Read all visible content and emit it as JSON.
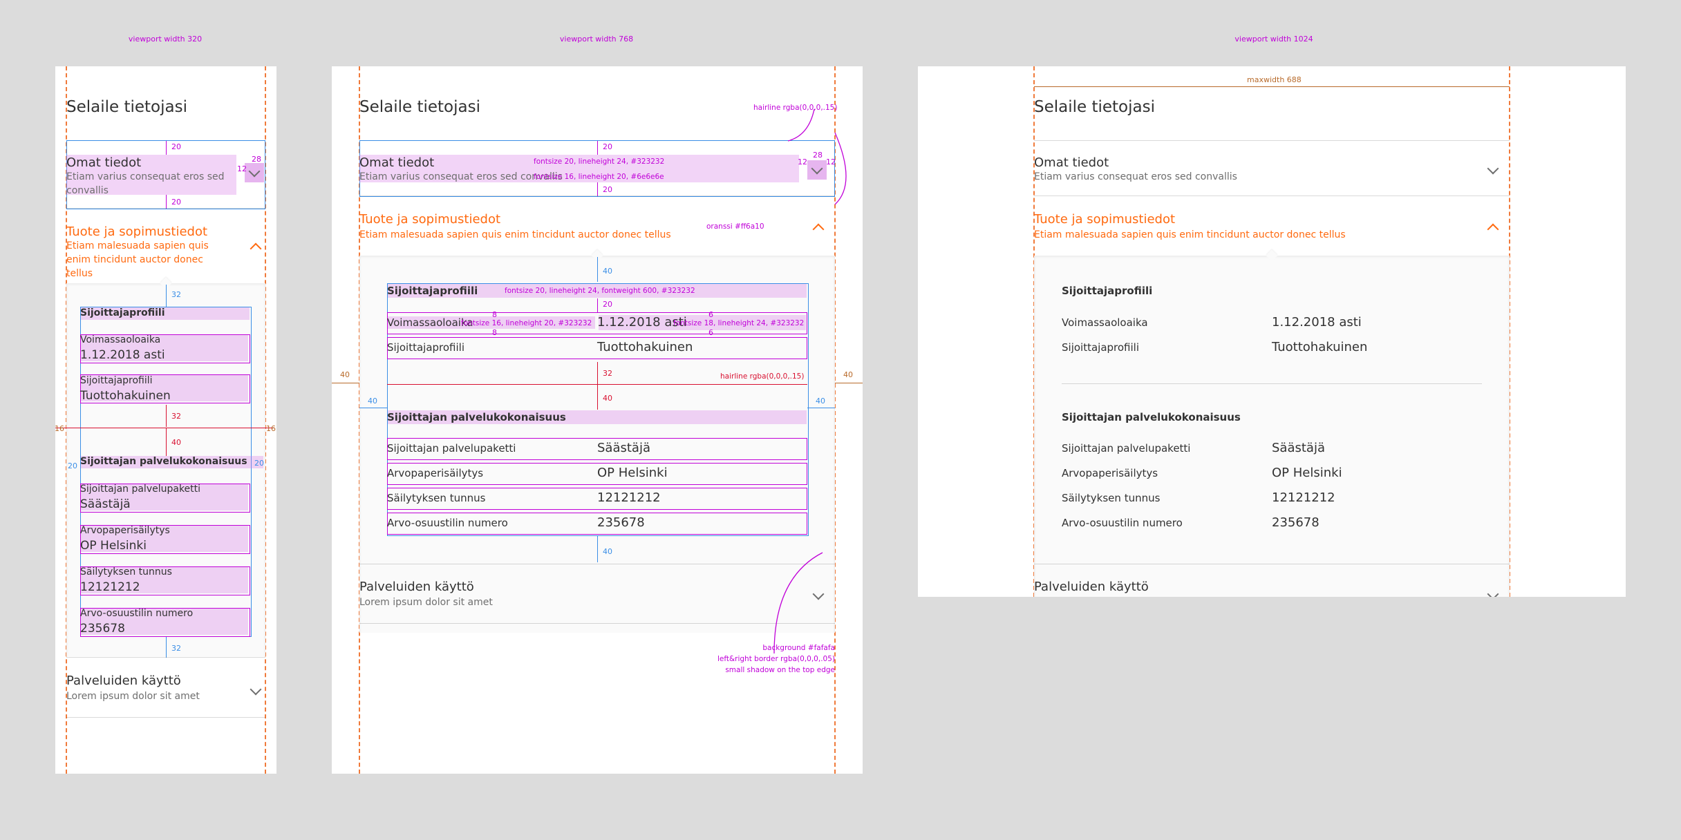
{
  "viewports": {
    "v320": "viewport width 320",
    "v768": "viewport width 768",
    "v1024": "viewport width 1024"
  },
  "page": {
    "title": "Selaile tietojasi",
    "sections": [
      {
        "title": "Omat tiedot",
        "subtitle": "Etiam varius consequat eros sed convallis",
        "expanded": false
      },
      {
        "title": "Tuote ja sopimustiedot",
        "subtitle": "Etiam malesuada sapien quis enim tincidunt auctor donec tellus",
        "expanded": true
      },
      {
        "title": "Palveluiden käyttö",
        "subtitle": "Lorem ipsum dolor sit amet",
        "expanded": false
      }
    ],
    "groups": [
      {
        "heading": "Sijoittajaprofiili",
        "rows": [
          {
            "label": "Voimassaoloaika",
            "value": "1.12.2018 asti"
          },
          {
            "label": "Sijoittajaprofiili",
            "value": "Tuottohakuinen"
          }
        ]
      },
      {
        "heading": "Sijoittajan palvelukokonaisuus",
        "rows": [
          {
            "label": "Sijoittajan palvelupaketti",
            "value": "Säästäjä"
          },
          {
            "label": "Arvopaperisäilytys",
            "value": "OP Helsinki"
          },
          {
            "label": "Säilytyksen tunnus",
            "value": "12121212"
          },
          {
            "label": "Arvo-osuustilin numero",
            "value": "235678"
          }
        ]
      }
    ]
  },
  "annotations": {
    "hairline_top": "hairline rgba(0,0,0,.15)",
    "title_font": "fontsize 20, lineheight 24, #323232",
    "subtitle_font": "fontsize 16, lineheight 20, #6e6e6e",
    "orange": "oranssi #ff6a10",
    "group_heading_font": "fontsize 20, lineheight 24, fontweight 600, #323232",
    "label_font": "fontsize 16, lineheight 20, #323232",
    "value_font": "fontsize 18, lineheight 24, #323232",
    "hairline_mid": "hairline rgba(0,0,0,.15)",
    "panel_bg": "background #fafafa",
    "panel_border": "left&right border rgba(0,0,0,.05)",
    "panel_shadow": "small shadow on the top edge",
    "maxwidth": "maxwidth 688"
  },
  "measures": {
    "m20": "20",
    "m28": "28",
    "m12": "12",
    "m32": "32",
    "m40": "40",
    "m16": "16",
    "m8": "8",
    "m6": "6"
  },
  "colors": {
    "accent_orange": "#ff6a10",
    "text": "#323232",
    "subtext": "#6e6e6e",
    "panel": "#fafafa"
  }
}
